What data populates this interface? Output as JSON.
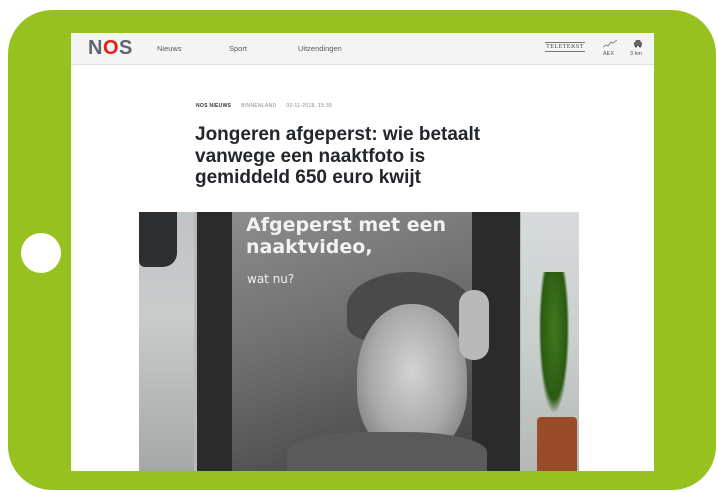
{
  "header": {
    "logo_left": "N",
    "logo_middle": "O",
    "logo_right": "S",
    "nav": [
      "Nieuws",
      "Sport",
      "Uitzendingen"
    ],
    "teletekst": "TELETEKST",
    "widgets": [
      {
        "icon": "stock-chart-icon",
        "label": "AEX"
      },
      {
        "icon": "car-icon",
        "label": "3 km"
      }
    ]
  },
  "article": {
    "source": "NOS NIEUWS",
    "category": "BINNENLAND",
    "date": "02-11-2018, 15:39",
    "title": "Jongeren afgeperst: wie betaalt vanwege een naaktfoto is gemiddeld 650 euro kwijt"
  },
  "photo": {
    "poster_title": "Afgeperst met een naaktvideo,",
    "poster_subtitle": "wat nu?"
  },
  "colors": {
    "frame": "#96c11f",
    "nos_red": "#e61e14",
    "headline": "#23262b"
  }
}
